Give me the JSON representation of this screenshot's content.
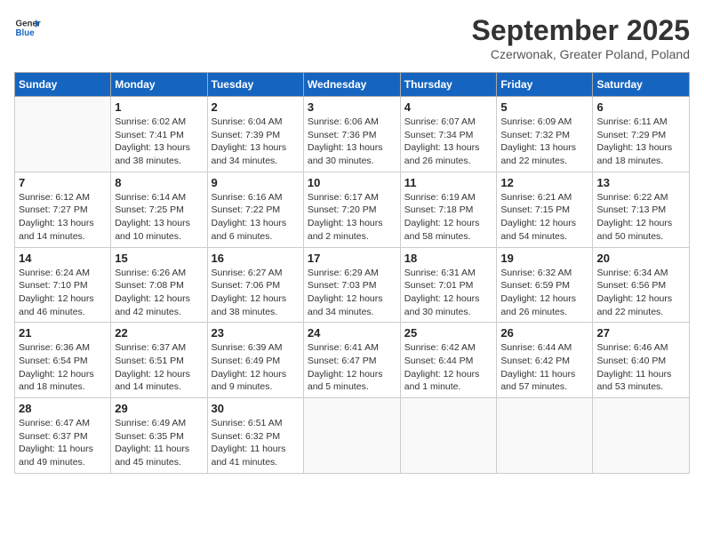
{
  "header": {
    "logo_line1": "General",
    "logo_line2": "Blue",
    "month_title": "September 2025",
    "subtitle": "Czerwonak, Greater Poland, Poland"
  },
  "days_of_week": [
    "Sunday",
    "Monday",
    "Tuesday",
    "Wednesday",
    "Thursday",
    "Friday",
    "Saturday"
  ],
  "weeks": [
    [
      {
        "day": "",
        "info": ""
      },
      {
        "day": "1",
        "info": "Sunrise: 6:02 AM\nSunset: 7:41 PM\nDaylight: 13 hours\nand 38 minutes."
      },
      {
        "day": "2",
        "info": "Sunrise: 6:04 AM\nSunset: 7:39 PM\nDaylight: 13 hours\nand 34 minutes."
      },
      {
        "day": "3",
        "info": "Sunrise: 6:06 AM\nSunset: 7:36 PM\nDaylight: 13 hours\nand 30 minutes."
      },
      {
        "day": "4",
        "info": "Sunrise: 6:07 AM\nSunset: 7:34 PM\nDaylight: 13 hours\nand 26 minutes."
      },
      {
        "day": "5",
        "info": "Sunrise: 6:09 AM\nSunset: 7:32 PM\nDaylight: 13 hours\nand 22 minutes."
      },
      {
        "day": "6",
        "info": "Sunrise: 6:11 AM\nSunset: 7:29 PM\nDaylight: 13 hours\nand 18 minutes."
      }
    ],
    [
      {
        "day": "7",
        "info": "Sunrise: 6:12 AM\nSunset: 7:27 PM\nDaylight: 13 hours\nand 14 minutes."
      },
      {
        "day": "8",
        "info": "Sunrise: 6:14 AM\nSunset: 7:25 PM\nDaylight: 13 hours\nand 10 minutes."
      },
      {
        "day": "9",
        "info": "Sunrise: 6:16 AM\nSunset: 7:22 PM\nDaylight: 13 hours\nand 6 minutes."
      },
      {
        "day": "10",
        "info": "Sunrise: 6:17 AM\nSunset: 7:20 PM\nDaylight: 13 hours\nand 2 minutes."
      },
      {
        "day": "11",
        "info": "Sunrise: 6:19 AM\nSunset: 7:18 PM\nDaylight: 12 hours\nand 58 minutes."
      },
      {
        "day": "12",
        "info": "Sunrise: 6:21 AM\nSunset: 7:15 PM\nDaylight: 12 hours\nand 54 minutes."
      },
      {
        "day": "13",
        "info": "Sunrise: 6:22 AM\nSunset: 7:13 PM\nDaylight: 12 hours\nand 50 minutes."
      }
    ],
    [
      {
        "day": "14",
        "info": "Sunrise: 6:24 AM\nSunset: 7:10 PM\nDaylight: 12 hours\nand 46 minutes."
      },
      {
        "day": "15",
        "info": "Sunrise: 6:26 AM\nSunset: 7:08 PM\nDaylight: 12 hours\nand 42 minutes."
      },
      {
        "day": "16",
        "info": "Sunrise: 6:27 AM\nSunset: 7:06 PM\nDaylight: 12 hours\nand 38 minutes."
      },
      {
        "day": "17",
        "info": "Sunrise: 6:29 AM\nSunset: 7:03 PM\nDaylight: 12 hours\nand 34 minutes."
      },
      {
        "day": "18",
        "info": "Sunrise: 6:31 AM\nSunset: 7:01 PM\nDaylight: 12 hours\nand 30 minutes."
      },
      {
        "day": "19",
        "info": "Sunrise: 6:32 AM\nSunset: 6:59 PM\nDaylight: 12 hours\nand 26 minutes."
      },
      {
        "day": "20",
        "info": "Sunrise: 6:34 AM\nSunset: 6:56 PM\nDaylight: 12 hours\nand 22 minutes."
      }
    ],
    [
      {
        "day": "21",
        "info": "Sunrise: 6:36 AM\nSunset: 6:54 PM\nDaylight: 12 hours\nand 18 minutes."
      },
      {
        "day": "22",
        "info": "Sunrise: 6:37 AM\nSunset: 6:51 PM\nDaylight: 12 hours\nand 14 minutes."
      },
      {
        "day": "23",
        "info": "Sunrise: 6:39 AM\nSunset: 6:49 PM\nDaylight: 12 hours\nand 9 minutes."
      },
      {
        "day": "24",
        "info": "Sunrise: 6:41 AM\nSunset: 6:47 PM\nDaylight: 12 hours\nand 5 minutes."
      },
      {
        "day": "25",
        "info": "Sunrise: 6:42 AM\nSunset: 6:44 PM\nDaylight: 12 hours\nand 1 minute."
      },
      {
        "day": "26",
        "info": "Sunrise: 6:44 AM\nSunset: 6:42 PM\nDaylight: 11 hours\nand 57 minutes."
      },
      {
        "day": "27",
        "info": "Sunrise: 6:46 AM\nSunset: 6:40 PM\nDaylight: 11 hours\nand 53 minutes."
      }
    ],
    [
      {
        "day": "28",
        "info": "Sunrise: 6:47 AM\nSunset: 6:37 PM\nDaylight: 11 hours\nand 49 minutes."
      },
      {
        "day": "29",
        "info": "Sunrise: 6:49 AM\nSunset: 6:35 PM\nDaylight: 11 hours\nand 45 minutes."
      },
      {
        "day": "30",
        "info": "Sunrise: 6:51 AM\nSunset: 6:32 PM\nDaylight: 11 hours\nand 41 minutes."
      },
      {
        "day": "",
        "info": ""
      },
      {
        "day": "",
        "info": ""
      },
      {
        "day": "",
        "info": ""
      },
      {
        "day": "",
        "info": ""
      }
    ]
  ]
}
